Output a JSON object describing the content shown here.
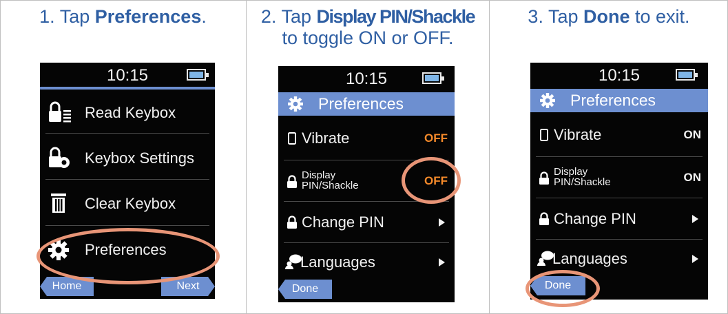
{
  "colors": {
    "step_text": "#2f5fa3",
    "title_bar": "#6d8fd0",
    "value_off": "#f58a2a",
    "highlight": "#e89577",
    "battery_fill": "#7fb5e6"
  },
  "step1": {
    "number": "1.",
    "pre": "Tap ",
    "bold": "Preferences",
    "post": ".",
    "screen": {
      "time": "10:15",
      "menu": [
        {
          "label": "Read Keybox",
          "icon": "lock-list-icon"
        },
        {
          "label": "Keybox Settings",
          "icon": "lock-gear-icon"
        },
        {
          "label": "Clear Keybox",
          "icon": "trash-icon"
        },
        {
          "label": "Preferences",
          "icon": "gear-icon"
        }
      ],
      "soft_left": "Home",
      "soft_right": "Next"
    }
  },
  "step2": {
    "number": "2.",
    "pre": "Tap ",
    "bold": "Display PIN/Shackle",
    "line2": "to toggle ON or OFF.",
    "screen": {
      "time": "10:15",
      "title": "Preferences",
      "rows": [
        {
          "label": "Vibrate",
          "value": "OFF"
        },
        {
          "label_line1": "Display",
          "label_line2": "PIN/Shackle",
          "value": "OFF"
        },
        {
          "label": "Change PIN"
        },
        {
          "label": "Languages"
        }
      ],
      "soft_left": "Done"
    }
  },
  "step3": {
    "number": "3.",
    "pre": "Tap ",
    "bold": "Done",
    "post": " to exit.",
    "screen": {
      "time": "10:15",
      "title": "Preferences",
      "rows": [
        {
          "label": "Vibrate",
          "value": "ON"
        },
        {
          "label_line1": "Display",
          "label_line2": "PIN/Shackle",
          "value": "ON"
        },
        {
          "label": "Change PIN"
        },
        {
          "label": "Languages"
        }
      ],
      "soft_left": "Done"
    }
  }
}
